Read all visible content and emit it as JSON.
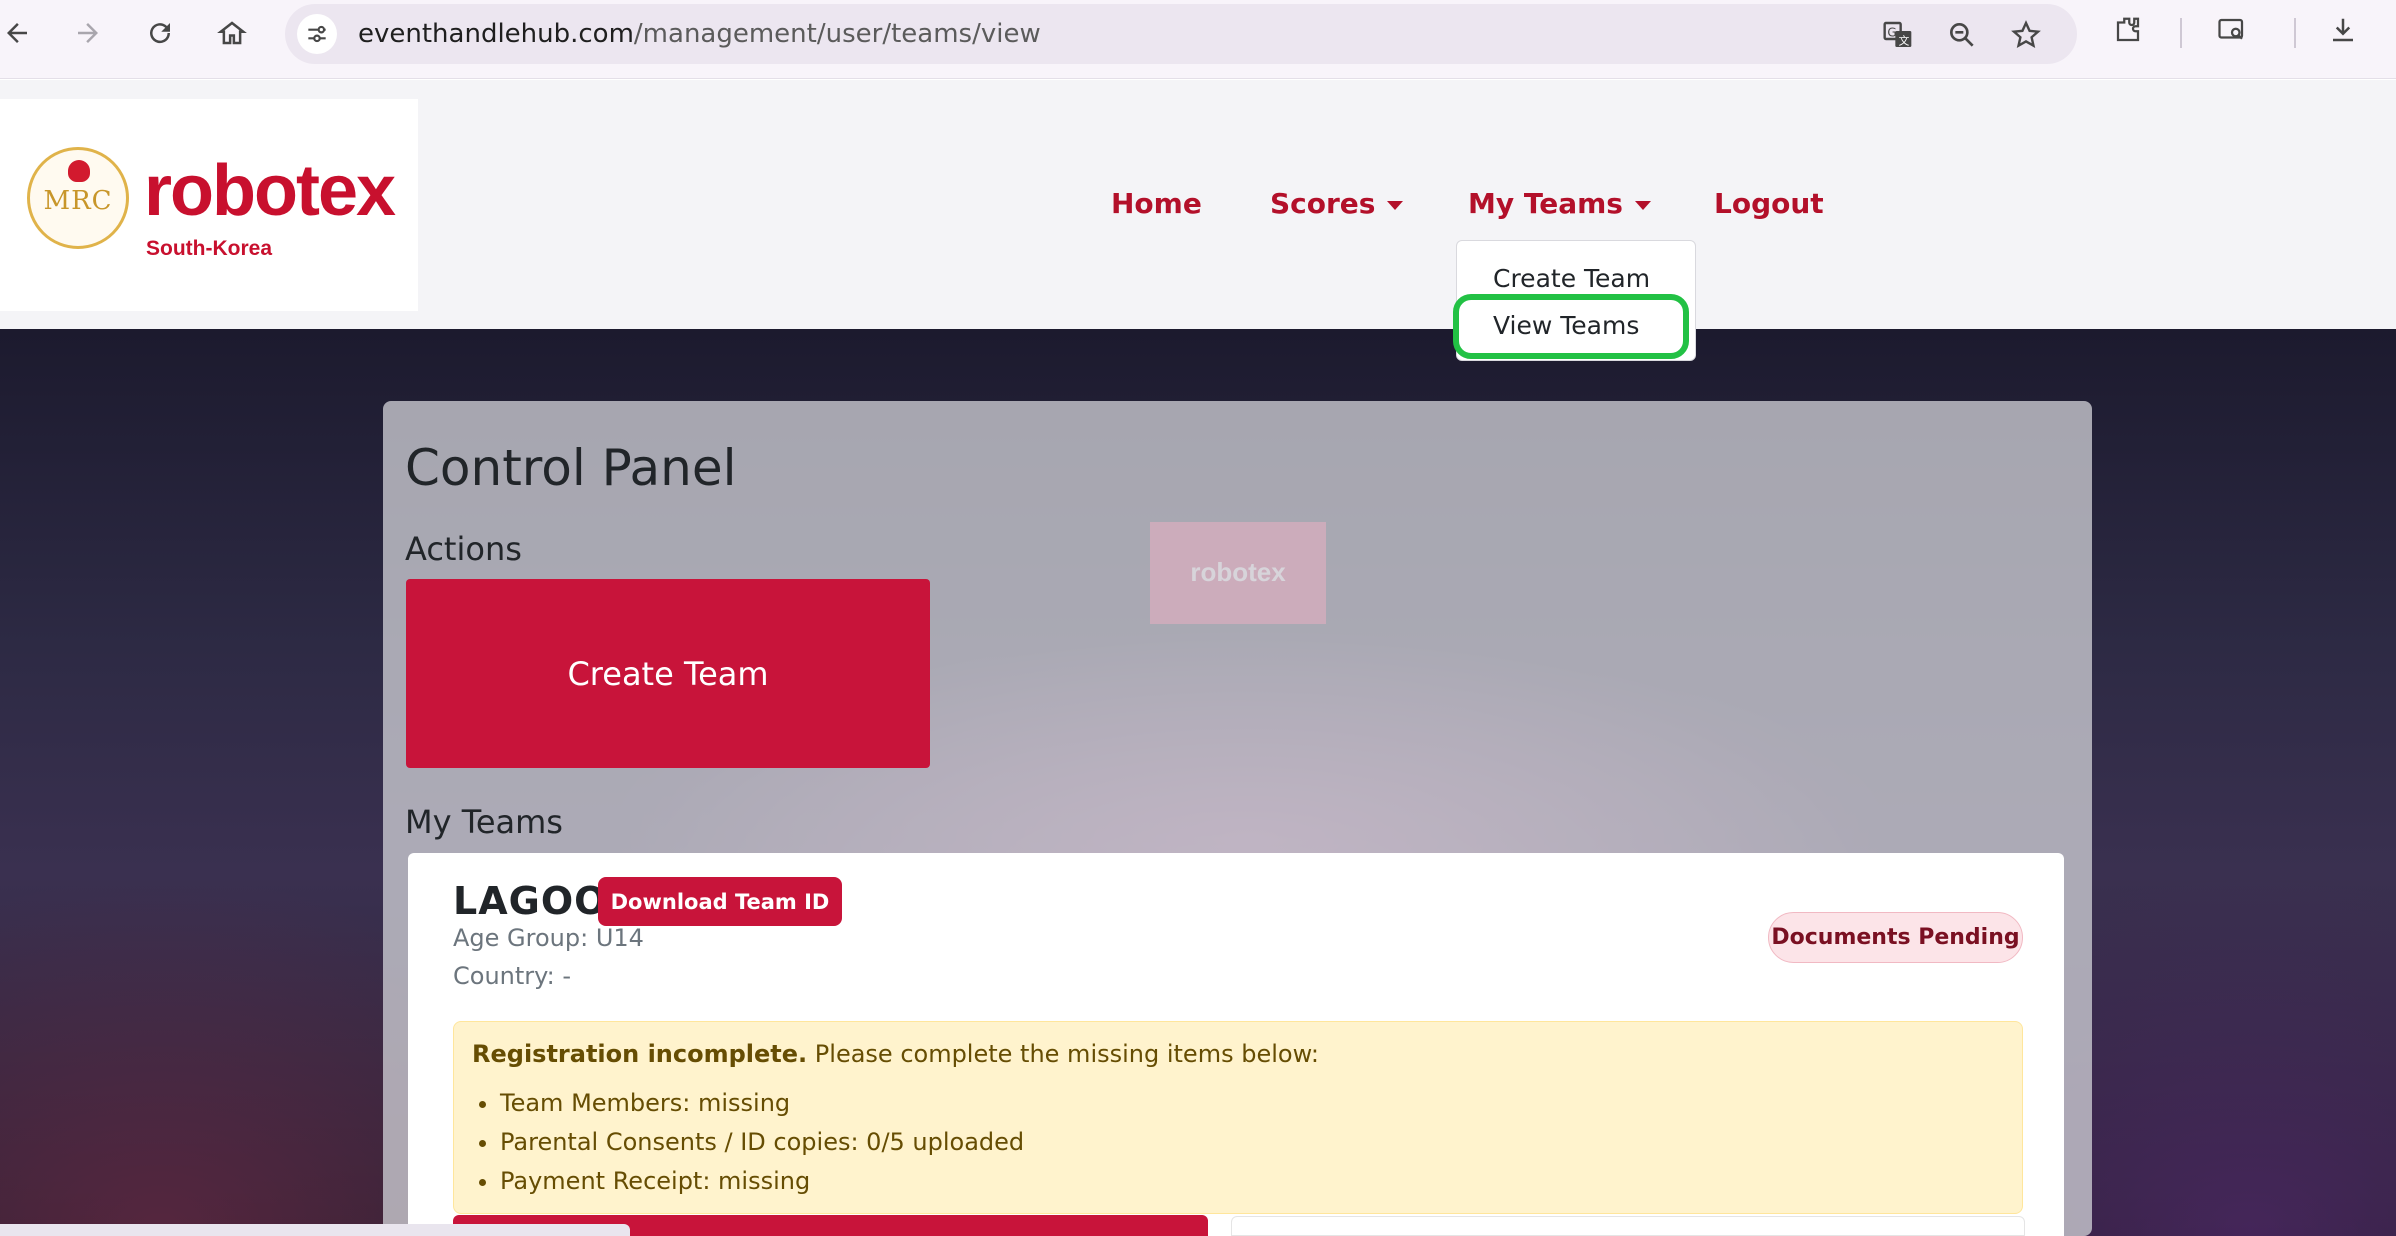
{
  "browser": {
    "url_host": "eventhandlehub.com",
    "url_path": "/management/user/teams/view"
  },
  "brand": {
    "seal_text": "MRC",
    "wordmark": "robotex",
    "subtitle": "South-Korea",
    "accent_color": "#c8102e"
  },
  "nav": {
    "home": "Home",
    "scores": "Scores",
    "my_teams": "My Teams",
    "logout": "Logout",
    "dropdown": {
      "create_team": "Create Team",
      "view_teams": "View Teams"
    }
  },
  "background": {
    "screen_text": "robotex"
  },
  "panel": {
    "title": "Control Panel",
    "actions_heading": "Actions",
    "create_team_card": "Create Team",
    "my_teams_heading": "My Teams"
  },
  "team": {
    "name": "LAGOON",
    "download_label": "Download Team ID",
    "age_group": "Age Group: U14",
    "country": "Country: -",
    "status": "Documents Pending",
    "alert": {
      "head_bold": "Registration incomplete.",
      "head_rest": " Please complete the missing items below:",
      "items": [
        "Team Members: missing",
        "Parental Consents / ID copies: 0/5 uploaded",
        "Payment Receipt: missing"
      ]
    }
  },
  "icons": [
    "back-icon",
    "forward-icon",
    "reload-icon",
    "home-icon",
    "site-info-icon",
    "translate-icon",
    "zoom-icon",
    "star-icon",
    "extensions-icon",
    "tab-search-icon",
    "download-icon"
  ]
}
